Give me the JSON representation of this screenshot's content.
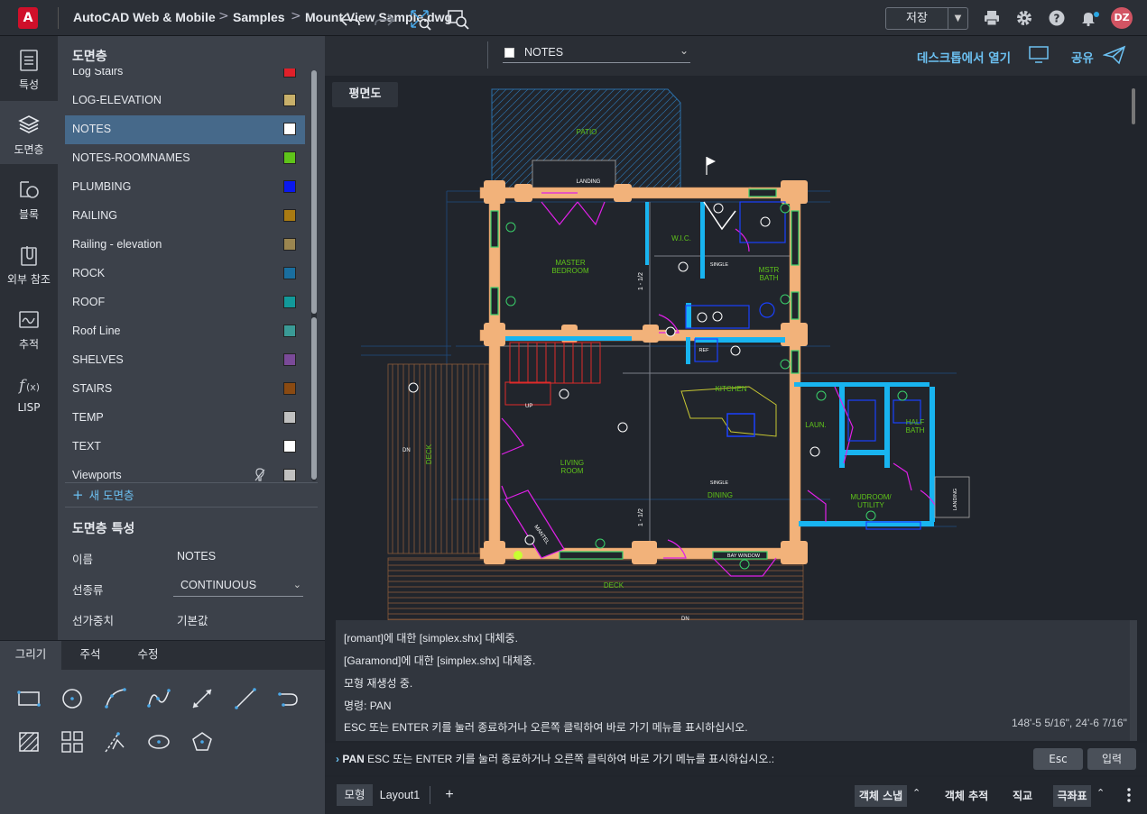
{
  "app": {
    "logo_letter": "A",
    "name": "AutoCAD Web & Mobile"
  },
  "breadcrumb": {
    "folder": "Samples",
    "file": "Mount View Sample.dwg",
    "separator": ">"
  },
  "titlebar": {
    "save_label": "저장",
    "avatar_initials": "DZ",
    "accent": "#2aa6e3"
  },
  "rail": [
    {
      "label": "특성",
      "icon": "properties-icon"
    },
    {
      "label": "도면층",
      "icon": "layers-icon"
    },
    {
      "label": "블록",
      "icon": "blocks-icon"
    },
    {
      "label": "외부 참조",
      "icon": "xref-icon"
    },
    {
      "label": "추적",
      "icon": "trace-icon"
    },
    {
      "label": "LISP",
      "icon": "lisp-icon"
    }
  ],
  "layers_panel": {
    "title": "도면층",
    "layers": [
      {
        "name": "Log Stairs",
        "color": "#e0202a"
      },
      {
        "name": "LOG-ELEVATION",
        "color": "#c8b06a"
      },
      {
        "name": "NOTES",
        "color": "#ffffff"
      },
      {
        "name": "NOTES-ROOMNAMES",
        "color": "#5fc41a"
      },
      {
        "name": "PLUMBING",
        "color": "#0a18ee"
      },
      {
        "name": "RAILING",
        "color": "#a97a12"
      },
      {
        "name": "Railing - elevation",
        "color": "#9a8550"
      },
      {
        "name": "ROCK",
        "color": "#1a6e9e"
      },
      {
        "name": "ROOF",
        "color": "#12999a"
      },
      {
        "name": "Roof Line",
        "color": "#3a9a96"
      },
      {
        "name": "SHELVES",
        "color": "#7a4a98"
      },
      {
        "name": "STAIRS",
        "color": "#8a4a12"
      },
      {
        "name": "TEMP",
        "color": "#c0c0c0"
      },
      {
        "name": "TEXT",
        "color": "#ffffff"
      },
      {
        "name": "Viewports",
        "color": "#c0c0c0"
      }
    ],
    "new_layer_label": "새 도면층"
  },
  "layer_properties": {
    "title": "도면층 특성",
    "name_label": "이름",
    "name_value": "NOTES",
    "linetype_label": "선종류",
    "linetype_value": "CONTINUOUS",
    "lineweight_label": "선가중치",
    "lineweight_value": "기본값"
  },
  "draw_tabs": [
    "그리기",
    "주석",
    "수정"
  ],
  "canvas": {
    "current_layer": "NOTES",
    "open_desktop_label": "데스크톱에서 열기",
    "share_label": "공유",
    "view_label": "평면도"
  },
  "plan_labels": {
    "patio": "PATIO",
    "landing": "LANDING",
    "master_bedroom": "MASTER\nBEDROOM",
    "wic": "W.I.C.",
    "mstr_bath": "MSTR\nBATH",
    "single": "SINGLE",
    "ref": "REF",
    "kitchen": "KITCHEN",
    "living_room": "LIVING\nROOM",
    "dining": "DINING",
    "laun": "LAUN.",
    "half_bath": "HALF\nBATH",
    "mudroom": "MUDROOM/\nUTILITY",
    "deck": "DECK",
    "mantel": "MANTEL",
    "dn": "DN",
    "up": "UP",
    "bay_window": "BAY WINDOW",
    "dim_a": "1 - 1/2",
    "dim_b": "1 - 1/2"
  },
  "command_history": [
    "[romant]에 대한 [simplex.shx] 대체중.",
    "[Garamond]에 대한 [simplex.shx] 대체중.",
    "모형 재생성 중.",
    "명령: PAN",
    "ESC 또는 ENTER 키를 눌러 종료하거나 오른쪽 클릭하여 바로 가기 메뉴를 표시하십시오."
  ],
  "coordinates": "148'-5 5/16\", 24'-6 7/16\"",
  "command_line": {
    "command": "PAN",
    "prompt": "ESC 또는 ENTER 키를 눌러 종료하거나 오른쪽 클릭하여 바로 가기 메뉴를 표시하십시오.:",
    "esc_label": "Esc",
    "enter_label": "입력"
  },
  "status_bar": {
    "tabs": [
      "모형",
      "Layout1"
    ],
    "add_label": "+",
    "osnap": "객체 스냅",
    "otrack": "객체 추적",
    "ortho": "직교",
    "polar": "극좌표"
  }
}
